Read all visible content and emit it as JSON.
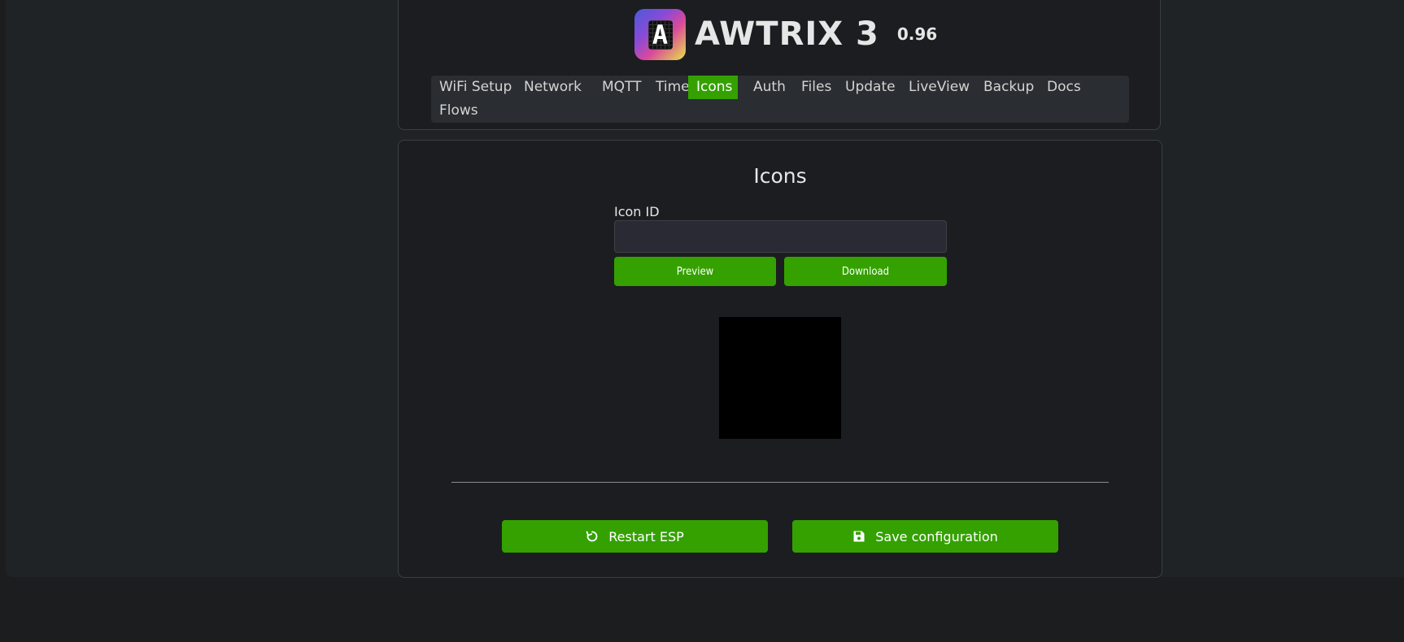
{
  "app": {
    "title": "AWTRIX 3",
    "version": "0.96",
    "logo_glyph": "A"
  },
  "nav": {
    "items": [
      {
        "label": "WiFi Setup",
        "active": false
      },
      {
        "label": "Network",
        "active": false
      },
      {
        "label": "MQTT",
        "active": false
      },
      {
        "label": "Time",
        "active": false
      },
      {
        "label": "Icons",
        "active": true
      },
      {
        "label": "Auth",
        "active": false
      },
      {
        "label": "Files",
        "active": false
      },
      {
        "label": "Update",
        "active": false
      },
      {
        "label": "LiveView",
        "active": false
      },
      {
        "label": "Backup",
        "active": false
      },
      {
        "label": "Docs",
        "active": false
      },
      {
        "label": "Flows",
        "active": false
      }
    ]
  },
  "icons_page": {
    "title": "Icons",
    "icon_id_label": "Icon ID",
    "icon_id_value": "",
    "icon_id_placeholder": "",
    "preview_label": "Preview",
    "download_label": "Download"
  },
  "footer": {
    "restart_label": "Restart ESP",
    "save_label": "Save configuration",
    "restart_icon": "restart-icon",
    "save_icon": "floppy-disk-icon"
  },
  "colors": {
    "accent": "#34a100",
    "background": "#1c1d1f",
    "card": "#1b1d20",
    "nav_bg": "#2a2d31"
  }
}
